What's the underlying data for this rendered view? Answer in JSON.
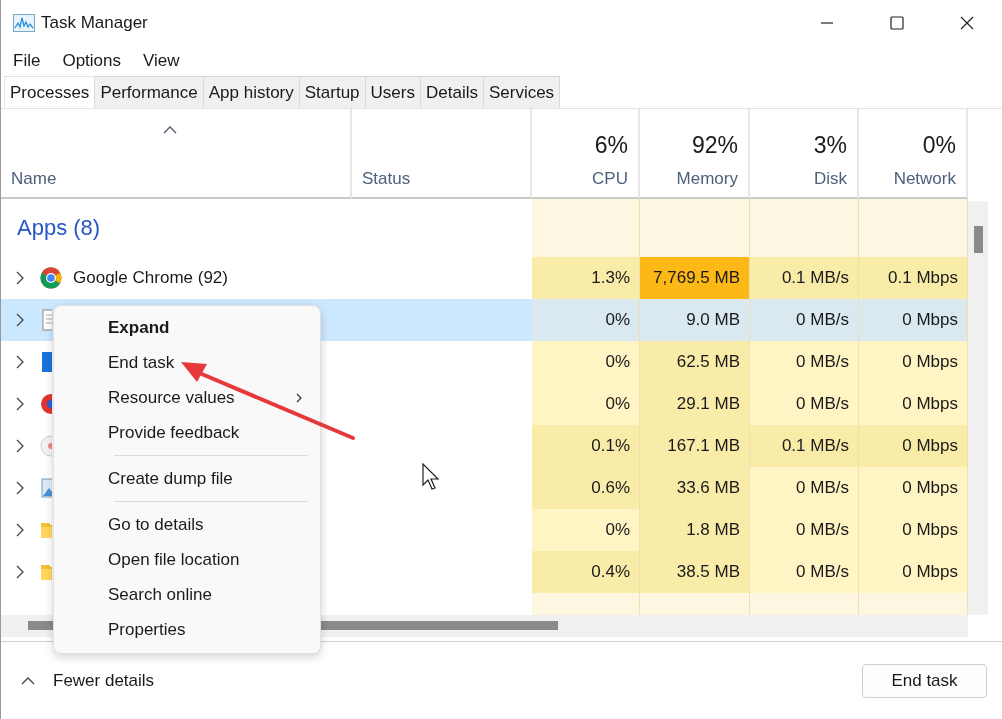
{
  "window": {
    "title": "Task Manager"
  },
  "menu_bar": [
    "File",
    "Options",
    "View"
  ],
  "tabs": [
    {
      "label": "Processes",
      "selected": true
    },
    {
      "label": "Performance",
      "selected": false
    },
    {
      "label": "App history",
      "selected": false
    },
    {
      "label": "Startup",
      "selected": false
    },
    {
      "label": "Users",
      "selected": false
    },
    {
      "label": "Details",
      "selected": false
    },
    {
      "label": "Services",
      "selected": false
    }
  ],
  "table": {
    "columns": [
      {
        "kind": "name",
        "label": "Name"
      },
      {
        "kind": "status",
        "label": "Status"
      },
      {
        "kind": "metric",
        "usage": "6%",
        "label": "CPU"
      },
      {
        "kind": "metric",
        "usage": "92%",
        "label": "Memory"
      },
      {
        "kind": "metric",
        "usage": "3%",
        "label": "Disk"
      },
      {
        "kind": "metric",
        "usage": "0%",
        "label": "Network"
      }
    ],
    "groups": [
      {
        "title": "Apps (8)",
        "rows": [
          {
            "name": "Google Chrome (92)",
            "kind": "browser",
            "selected": false,
            "cells": [
              {
                "value": "1.3%",
                "color": "#f9eca8"
              },
              {
                "value": "7,769.5 MB",
                "color": "#fbb817"
              },
              {
                "value": "0.1 MB/s",
                "color": "#f9eca8"
              },
              {
                "value": "0.1 Mbps",
                "color": "#f9eca8"
              }
            ]
          },
          {
            "kind": "document",
            "selected": true,
            "cells": [
              {
                "value": "0%"
              },
              {
                "value": "9.0 MB"
              },
              {
                "value": "0 MB/s"
              },
              {
                "value": "0 Mbps"
              }
            ]
          },
          {
            "kind": "tile",
            "selected": false,
            "cells": [
              {
                "value": "0%",
                "color": "#fff4c4"
              },
              {
                "value": "62.5 MB",
                "color": "#f9eca8"
              },
              {
                "value": "0 MB/s",
                "color": "#fff4c4"
              },
              {
                "value": "0 Mbps",
                "color": "#fff4c4"
              }
            ]
          },
          {
            "kind": "disc",
            "selected": false,
            "cells": [
              {
                "value": "0%",
                "color": "#fff4c4"
              },
              {
                "value": "29.1 MB",
                "color": "#f9eca8"
              },
              {
                "value": "0 MB/s",
                "color": "#fff4c4"
              },
              {
                "value": "0 Mbps",
                "color": "#fff4c4"
              }
            ]
          },
          {
            "kind": "dot",
            "selected": false,
            "cells": [
              {
                "value": "0.1%",
                "color": "#f9eca8"
              },
              {
                "value": "167.1 MB",
                "color": "#f9eca8"
              },
              {
                "value": "0.1 MB/s",
                "color": "#f9eca8"
              },
              {
                "value": "0 Mbps",
                "color": "#f9eca8"
              }
            ]
          },
          {
            "kind": "image",
            "selected": false,
            "cells": [
              {
                "value": "0.6%",
                "color": "#f9eca8"
              },
              {
                "value": "33.6 MB",
                "color": "#f9eca8"
              },
              {
                "value": "0 MB/s",
                "color": "#fff4c4"
              },
              {
                "value": "0 Mbps",
                "color": "#fff4c4"
              }
            ]
          },
          {
            "kind": "folder",
            "selected": false,
            "cells": [
              {
                "value": "0%",
                "color": "#fff4c4"
              },
              {
                "value": "1.8 MB",
                "color": "#f9eca8"
              },
              {
                "value": "0 MB/s",
                "color": "#fff4c4"
              },
              {
                "value": "0 Mbps",
                "color": "#fff4c4"
              }
            ]
          },
          {
            "kind": "folder",
            "selected": false,
            "cells": [
              {
                "value": "0.4%",
                "color": "#f9eca8"
              },
              {
                "value": "38.5 MB",
                "color": "#f9eca8"
              },
              {
                "value": "0 MB/s",
                "color": "#fff4c4"
              },
              {
                "value": "0 Mbps",
                "color": "#fff4c4"
              }
            ]
          }
        ]
      }
    ]
  },
  "context_menu": {
    "items": [
      {
        "kind": "item",
        "label": "Expand",
        "default": true,
        "submenu": false
      },
      {
        "kind": "item",
        "label": "End task",
        "default": false,
        "submenu": false
      },
      {
        "kind": "item",
        "label": "Resource values",
        "default": false,
        "submenu": true
      },
      {
        "kind": "item",
        "label": "Provide feedback",
        "default": false,
        "submenu": false
      },
      {
        "kind": "separator"
      },
      {
        "kind": "item",
        "label": "Create dump file",
        "default": false,
        "submenu": false
      },
      {
        "kind": "separator"
      },
      {
        "kind": "item",
        "label": "Go to details",
        "default": false,
        "submenu": false
      },
      {
        "kind": "item",
        "label": "Open file location",
        "default": false,
        "submenu": false
      },
      {
        "kind": "item",
        "label": "Search online",
        "default": false,
        "submenu": false
      },
      {
        "kind": "item",
        "label": "Properties",
        "default": false,
        "submenu": false
      }
    ]
  },
  "footer": {
    "toggle": "Fewer details",
    "button": "End task"
  }
}
